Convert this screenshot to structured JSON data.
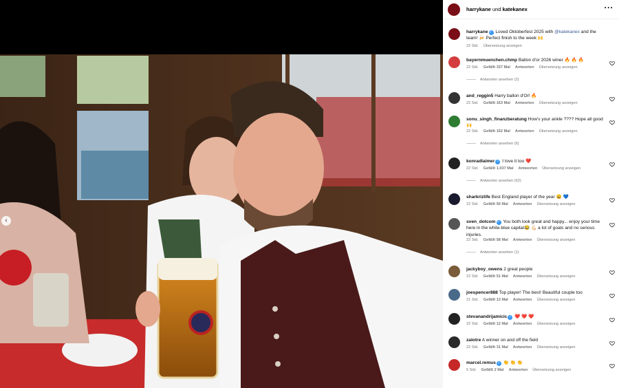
{
  "header": {
    "user1": "harrykane",
    "joiner": " und ",
    "user2": "katekanex"
  },
  "caption": {
    "user": "harrykane",
    "text_before": " Loved Oktoberfest 2025 with ",
    "mention": "@katekanex",
    "text_after": " and the team! 🍻 Perfect finish to the week 🙌",
    "time": "22 Std.",
    "translate": "Übersetzung anzeigen"
  },
  "labels": {
    "reply": "Antworten",
    "translate": "Übersetzung anzeigen"
  },
  "comments": [
    {
      "user": "bayernmuenchen.chmp",
      "verified": false,
      "text": "Ballon d'or 2026 winer 🔥 🔥 🔥",
      "time": "22 Std.",
      "likes": "Gefällt 337 Mal",
      "replies": "Antworten ansehen (2)"
    },
    {
      "user": "and_reggin5",
      "verified": false,
      "text": "Harry ballon d'Or! 🔥",
      "time": "22 Std.",
      "likes": "Gefällt 163 Mal",
      "replies": ""
    },
    {
      "user": "sonu_singh_finanzberatung",
      "verified": false,
      "text": "How's your ankle ???? Hope all good 🙌",
      "time": "22 Std.",
      "likes": "Gefällt 152 Mal",
      "replies": "Antworten ansehen (6)"
    },
    {
      "user": "konradlaimer",
      "verified": true,
      "text": "I love it too ❤️",
      "time": "22 Std.",
      "likes": "Gefällt 1.037 Mal",
      "replies": "Antworten ansehen (52)"
    },
    {
      "user": "sharkrizlife",
      "verified": false,
      "text": "Best England player of the year 😀 💙",
      "time": "22 Std.",
      "likes": "Gefällt 50 Mal",
      "replies": ""
    },
    {
      "user": "sven_dotcom",
      "verified": true,
      "text": "You both look great and happy... enjoy your time here in the white-blue capital😂 💪🏻 a lot of goals and no serious injuries.",
      "time": "22 Std.",
      "likes": "Gefällt 58 Mal",
      "replies": "Antworten ansehen (1)"
    },
    {
      "user": "jackyboy_owens",
      "verified": false,
      "text": "2 great people",
      "time": "22 Std.",
      "likes": "Gefällt 51 Mal",
      "replies": ""
    },
    {
      "user": "joespencer888",
      "verified": false,
      "text": "Top player! The best! Beautiful couple too",
      "time": "21 Std.",
      "likes": "Gefällt 13 Mal",
      "replies": ""
    },
    {
      "user": "stevanandrijamicic",
      "verified": true,
      "text": "❤️ ❤️ ❤️",
      "time": "22 Std.",
      "likes": "Gefällt 12 Mal",
      "replies": ""
    },
    {
      "user": "zalotre",
      "verified": false,
      "text": "A winner on and off the field",
      "time": "22 Std.",
      "likes": "Gefällt 31 Mal",
      "replies": ""
    },
    {
      "user": "marcel.remus",
      "verified": true,
      "text": "👏 👏 👏",
      "time": "5 Std.",
      "likes": "Gefällt 2 Mal",
      "replies": ""
    }
  ],
  "colors": {
    "mention": "#385898",
    "verified": "#3897f0",
    "meta": "#737373"
  }
}
